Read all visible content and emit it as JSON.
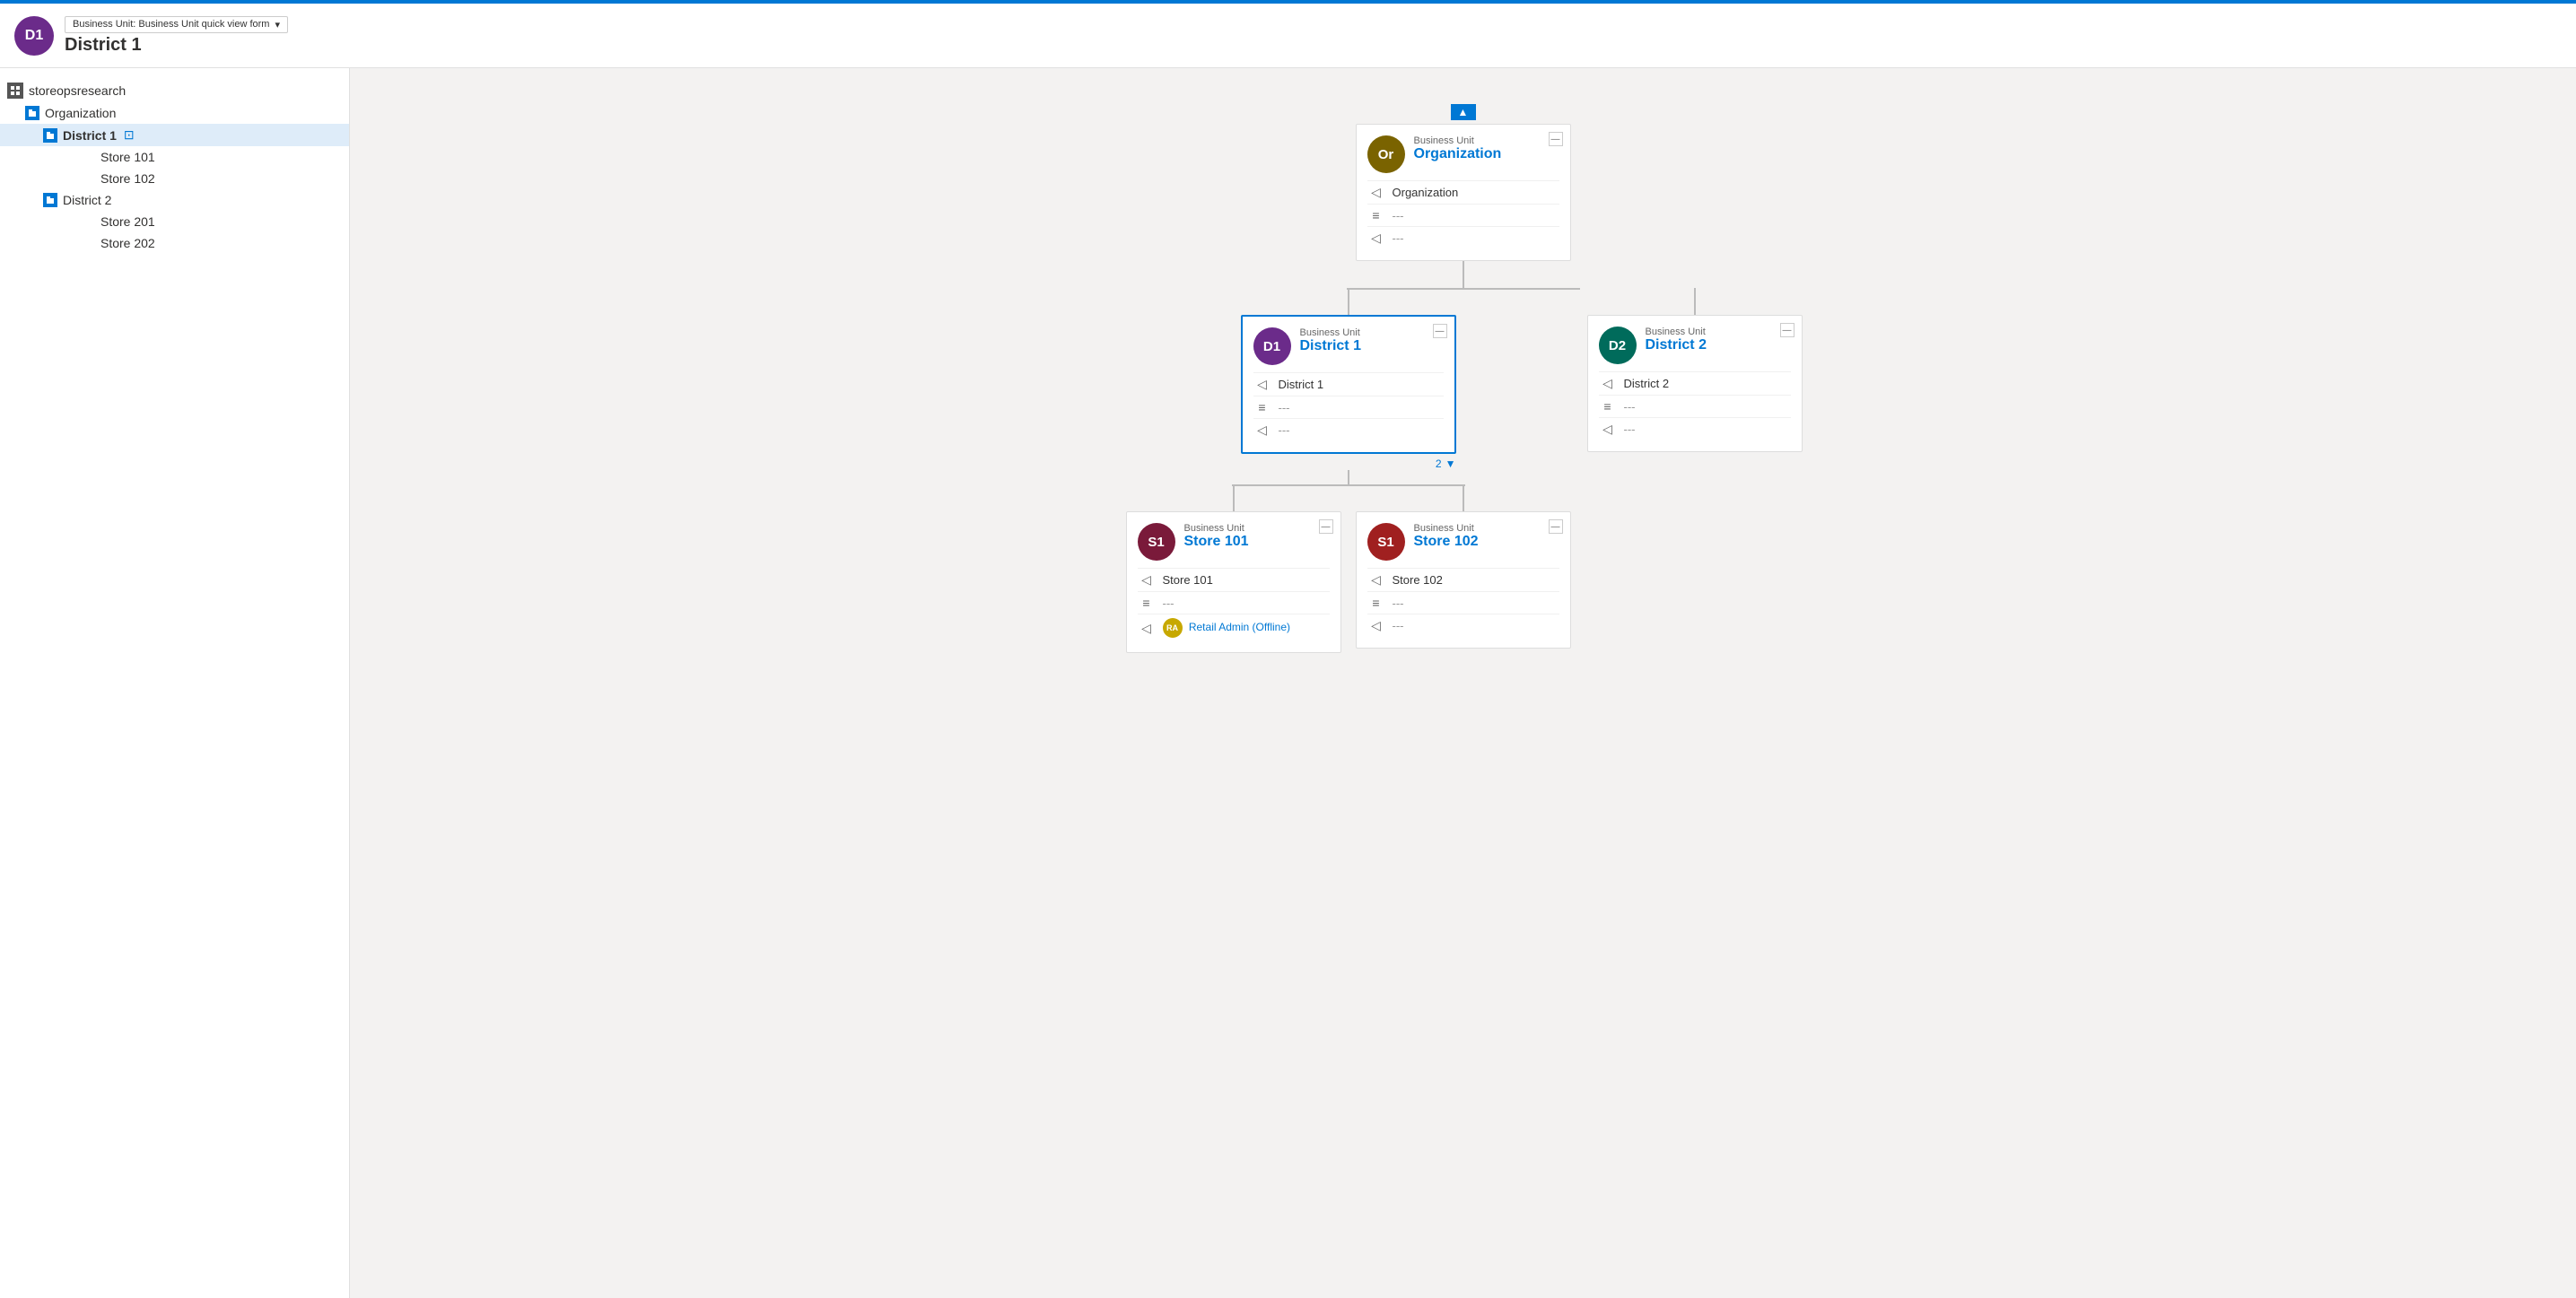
{
  "header": {
    "avatar_initials": "D1",
    "avatar_bg": "#6b2b8a",
    "quick_view_label": "Business Unit: Business Unit quick view form",
    "title": "District 1"
  },
  "sidebar": {
    "root": {
      "label": "storeopsresearch",
      "icon": "grid"
    },
    "items": [
      {
        "id": "org",
        "label": "Organization",
        "level": "level1",
        "type": "folder"
      },
      {
        "id": "district1",
        "label": "District 1",
        "level": "level2",
        "type": "folder",
        "selected": true,
        "hasExternalLink": true
      },
      {
        "id": "store101",
        "label": "Store 101",
        "level": "level4",
        "type": "item"
      },
      {
        "id": "store102",
        "label": "Store 102",
        "level": "level4",
        "type": "item"
      },
      {
        "id": "district2",
        "label": "District 2",
        "level": "level2",
        "type": "folder"
      },
      {
        "id": "store201",
        "label": "Store 201",
        "level": "level4",
        "type": "item"
      },
      {
        "id": "store202",
        "label": "Store 202",
        "level": "level4",
        "type": "item"
      }
    ]
  },
  "orgchart": {
    "up_arrow_label": "▲",
    "org_node": {
      "avatar_initials": "Or",
      "avatar_bg": "#7a6300",
      "card_type": "Business Unit",
      "card_name": "Organization",
      "row1_value": "Organization",
      "row2_value": "---",
      "row3_value": "---"
    },
    "district1_node": {
      "avatar_initials": "D1",
      "avatar_bg": "#6b2b8a",
      "card_type": "Business Unit",
      "card_name": "District 1",
      "row1_value": "District 1",
      "row2_value": "---",
      "row3_value": "---",
      "selected": true
    },
    "district2_node": {
      "avatar_initials": "D2",
      "avatar_bg": "#006b5b",
      "card_type": "Business Unit",
      "card_name": "District 2",
      "row1_value": "District 2",
      "row2_value": "---",
      "row3_value": "---"
    },
    "store101_node": {
      "avatar_initials": "S1",
      "avatar_bg": "#7a1a3a",
      "card_type": "Business Unit",
      "card_name": "Store 101",
      "row1_value": "Store 101",
      "row2_value": "---",
      "row3_value": "Retail Admin (Offline)",
      "has_ra": true
    },
    "store102_node": {
      "avatar_initials": "S1",
      "avatar_bg": "#a02020",
      "card_type": "Business Unit",
      "card_name": "Store 102",
      "row1_value": "Store 102",
      "row2_value": "---",
      "row3_value": "---"
    },
    "children_count": "2",
    "children_arrow": "▼"
  }
}
